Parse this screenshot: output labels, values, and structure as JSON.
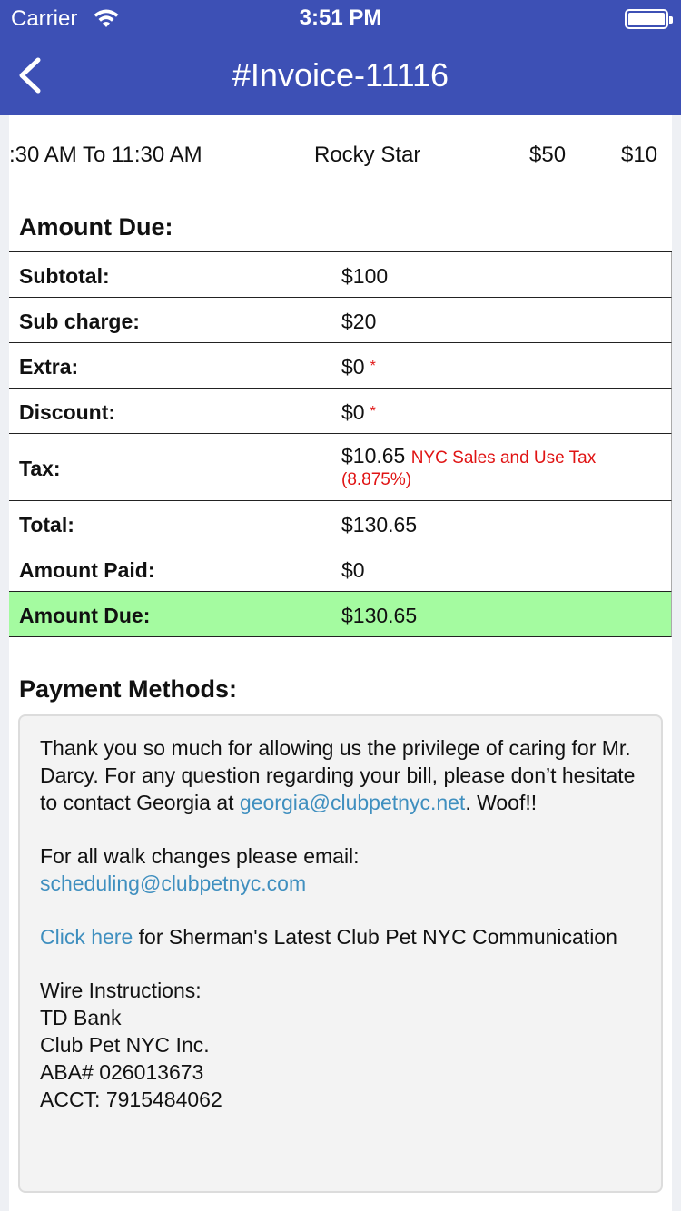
{
  "status_bar": {
    "carrier": "Carrier",
    "time": "3:51 PM"
  },
  "nav": {
    "title": "#Invoice-11116",
    "back_icon": "chevron-left-icon"
  },
  "service_row": {
    "time": ":30 AM To 11:30 AM",
    "walker": "Rocky Star",
    "rate": "$50",
    "extra": "$10"
  },
  "amount_due_section": {
    "title": "Amount Due:",
    "rows": [
      {
        "label": "Subtotal:",
        "value": "$100"
      },
      {
        "label": "Sub charge:",
        "value": "$20"
      },
      {
        "label": "Extra:",
        "value": "$0",
        "required_mark": "*"
      },
      {
        "label": "Discount:",
        "value": "$0",
        "required_mark": "*"
      },
      {
        "label": "Tax:",
        "value": "$10.65",
        "note_line1": "NYC Sales and Use Tax",
        "note_line2": "(8.875%)"
      },
      {
        "label": "Total:",
        "value": "$130.65"
      },
      {
        "label": "Amount Paid:",
        "value": "$0"
      },
      {
        "label": "Amount Due:",
        "value": "$130.65"
      }
    ],
    "highlight_color": "#a4fba0"
  },
  "payment_methods": {
    "title": "Payment Methods:",
    "thanks_text": "Thank you so much for allowing us the privilege of caring for Mr. Darcy. For any question regarding your bill, please don’t hesitate to contact Georgia at",
    "thanks_email": "georgia@clubpetnyc.net",
    "thanks_suffix": ". Woof!!",
    "walk_changes_text": "For all walk changes please email:",
    "walk_changes_email": "scheduling@clubpetnyc.com",
    "click_here": "Click here",
    "click_here_suffix": " for Sherman's Latest Club Pet NYC Communication",
    "wire": {
      "heading": "Wire Instructions:",
      "bank": "TD Bank",
      "company": "Club Pet NYC Inc.",
      "aba": "ABA# 026013673",
      "acct": "ACCT: 7915484062"
    }
  },
  "colors": {
    "nav_bar": "#3d50b5",
    "link": "#3f8fbf",
    "note_red": "#e01414"
  }
}
